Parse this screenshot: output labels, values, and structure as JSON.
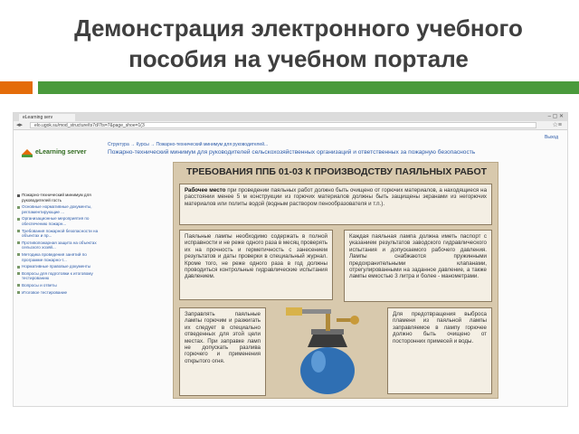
{
  "slide": {
    "title": "Демонстрация электронного учебного пособия на учебном портале",
    "colors": {
      "orange": "#e46c0a",
      "green": "#4a9a3c",
      "title": "#3f3f3f"
    }
  },
  "browser": {
    "tab_title": "eLearning serv",
    "url": "elo.ugok.su/mod_structure/ts7d/7ts=7&page_shoe=1(3",
    "logo_text": "eLearning server",
    "top_right_text": "Выход"
  },
  "content": {
    "breadcrumb": "Структура → Курсы → Пожарно-технический минимум для руководителей...",
    "course_title": "Пожарно-технический минимум для руководителей сельскохозяйственных организаций и ответственных за пожарную безопасность",
    "sidebar_items": [
      "Пожарно-технический минимум для руководителей гость",
      "Основные нормативные документы, регламентирующие ...",
      "Организационные мероприятия по обеспечению пожарн...",
      "Требования пожарной безопасности на объектах и пр...",
      "Противопожарная защита на объектах сельского хозяй...",
      "Методика проведения занятий по программе пожарно-т...",
      "Нормативные правовые документы",
      "Вопросы для подготовки к итоговому тестированию",
      "Вопросы и ответы",
      "Итоговое тестирование"
    ],
    "poster": {
      "heading": "ТРЕБОВАНИЯ ППБ 01-03 К ПРОИЗВОДСТВУ ПАЯЛЬНЫХ РАБОТ",
      "box1_bold": "Рабочее место",
      "box1_text": " при проведении паяльных работ должно быть очищено от горючих материалов, а находящиеся на расстоянии менее 5 м конструкции из горючих материалов должны быть защищены экранами из негорючих материалов или политы водой (водным раствором пенообразователя и т.п.).",
      "box2_text": "Паяльные лампы необходимо содержать в полной исправности и не реже одного раза в месяц проверять их на прочность и герметичность с занесением результатов и даты проверки в специальный журнал. Кроме того, не реже одного раза в год должны проводиться контрольные гидравлические испытания давлением.",
      "box3_text": "Каждая паяльная лампа должна иметь паспорт с указанием результатов заводского гидравлического испытания и допускаемого рабочего давления. Лампы снабжаются пружинными предохранительными клапанами, отрегулированными на заданное давление, а также лампы емкостью 3 литра и более - манометрами.",
      "box4_text": "Заправлять паяльные лампы горючим и разжигать их следует в специально отведенных для этой цели местах. При заправке ламп не допускать разлива горючего и применения открытого огня.",
      "box5_text": "Для предотвращения выброса пламени из паяльной лампы заправляемое в лампу горючее должно быть очищено от посторонних примесей и воды."
    }
  }
}
